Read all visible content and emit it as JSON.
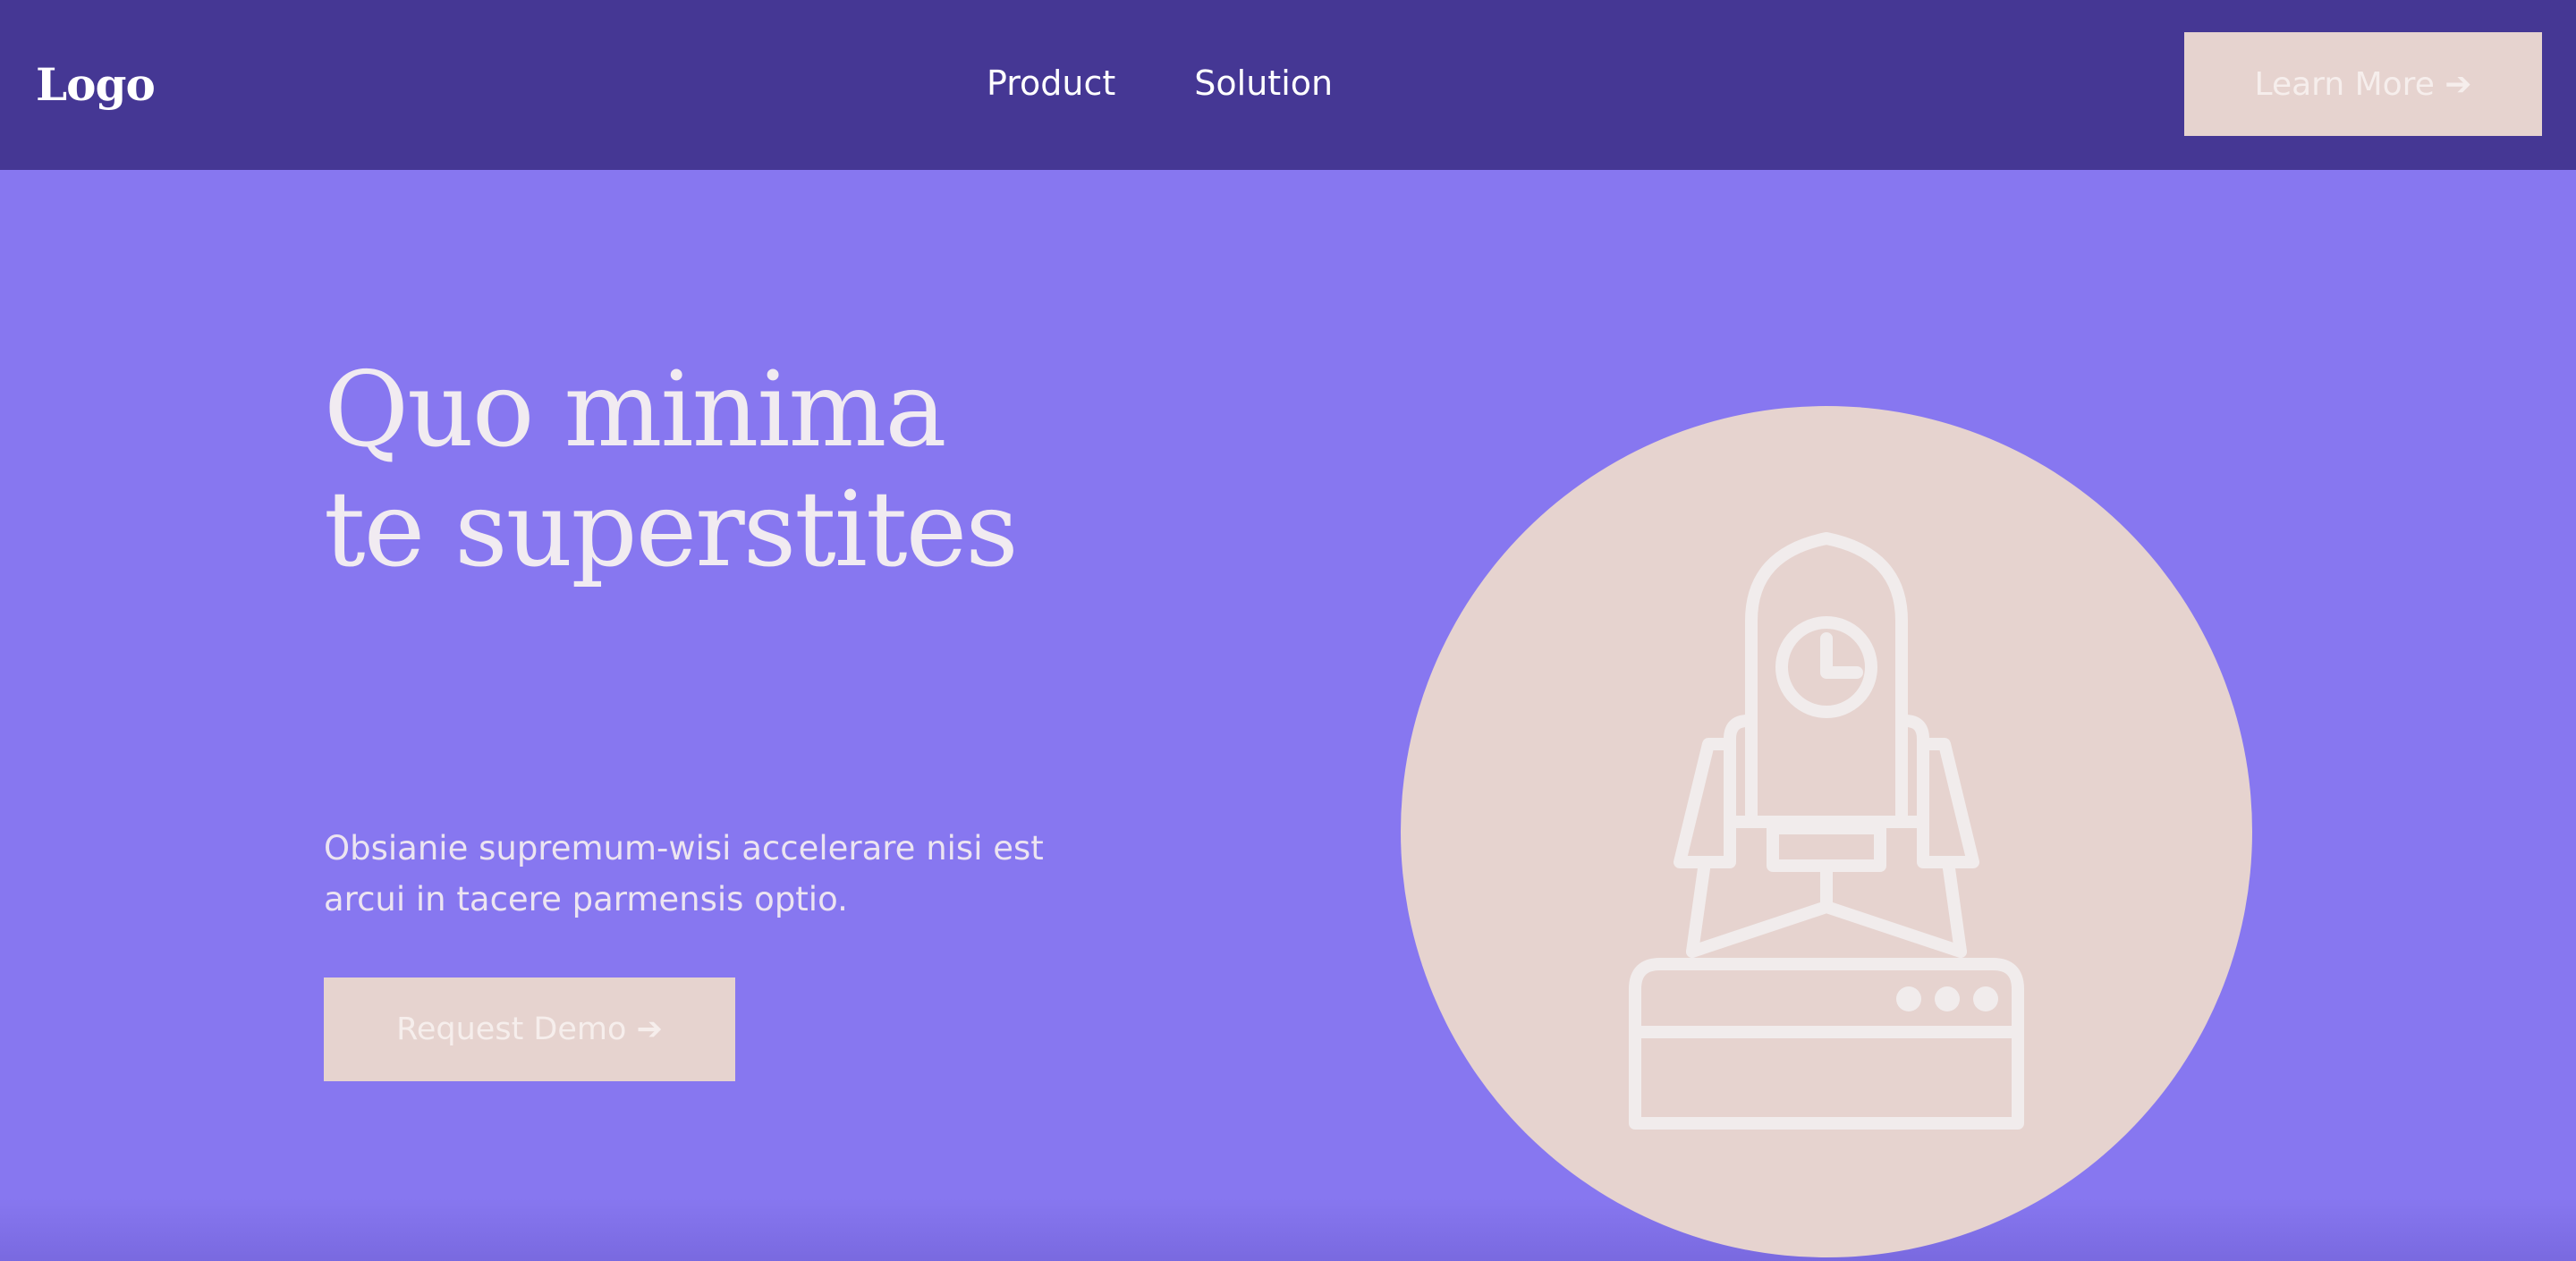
{
  "header": {
    "logo": "Logo",
    "nav": [
      {
        "label": "Product"
      },
      {
        "label": "Solution"
      }
    ],
    "cta_label": "Learn More ➔"
  },
  "hero": {
    "headline_lines": [
      "Quo minima",
      "te superstites"
    ],
    "subtext_lines": [
      "Obsianie supremum-wisi accelerare nisi est",
      "arcui in tacere parmensis optio."
    ],
    "button_label": "Request Demo ➔",
    "illustration_icon": "rocket-launch-icon"
  },
  "colors": {
    "header_bg": "#453794",
    "hero_bg": "#8777f0",
    "button_bg": "#e6d3cf",
    "circle_bg": "#e6d3cf",
    "icon_stroke": "#f1ecec"
  }
}
